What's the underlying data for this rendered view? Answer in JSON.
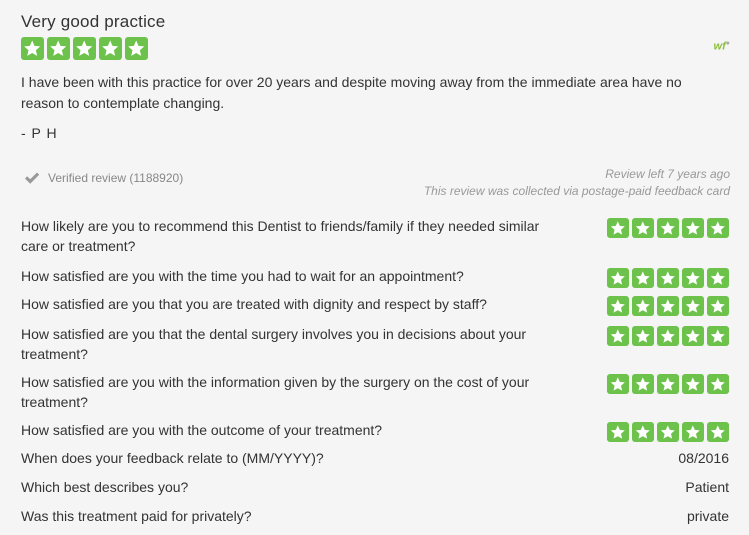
{
  "review": {
    "title": "Very good practice",
    "rating": 5,
    "logo": "wf",
    "body": "I have been with this practice for over 20 years and despite moving away from the immediate area have no reason to contemplate changing.",
    "author": "- P H",
    "verified": "Verified review (1188920)",
    "review_left": "Review left 7 years ago",
    "collected": "This review was collected via postage-paid feedback card"
  },
  "questions": [
    {
      "q": "How likely are you to recommend this Dentist to friends/family if they needed similar care or treatment?",
      "rating": 5
    },
    {
      "q": "How satisfied are you with the time you had to wait for an appointment?",
      "rating": 5
    },
    {
      "q": "How satisfied are you that you are treated with dignity and respect by staff?",
      "rating": 5
    },
    {
      "q": "How satisfied are you that the dental surgery involves you in decisions about your treatment?",
      "rating": 5
    },
    {
      "q": "How satisfied are you with the information given by the surgery on the cost of your treatment?",
      "rating": 5
    },
    {
      "q": "How satisfied are you with the outcome of your treatment?",
      "rating": 5
    }
  ],
  "details": [
    {
      "q": "When does your feedback relate to (MM/YYYY)?",
      "a": "08/2016"
    },
    {
      "q": "Which best describes you?",
      "a": "Patient"
    },
    {
      "q": "Was this treatment paid for privately?",
      "a": "private"
    }
  ],
  "colors": {
    "star": "#6cc24a",
    "text": "#333333",
    "muted": "#999999"
  }
}
